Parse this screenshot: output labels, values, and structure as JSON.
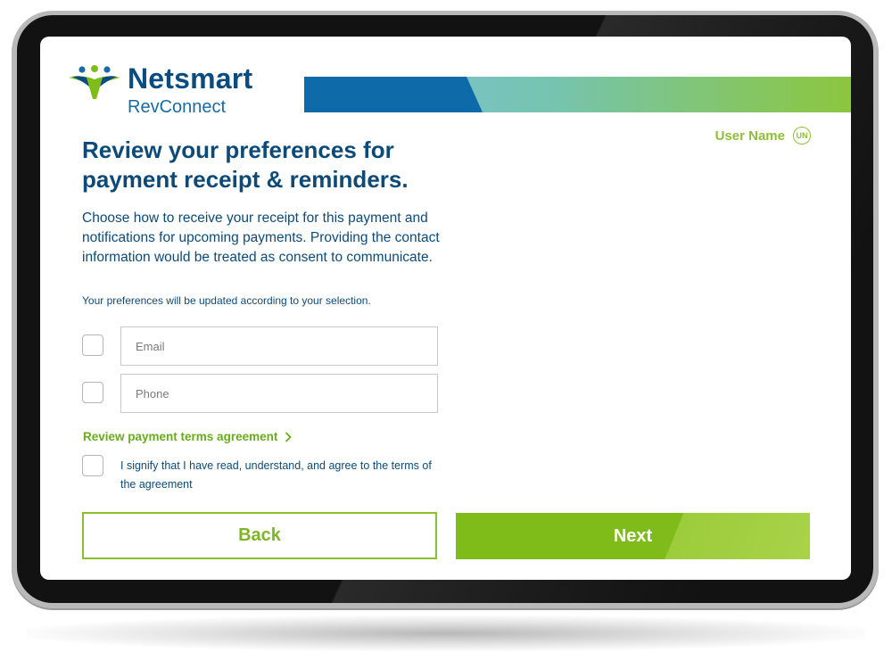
{
  "header": {
    "brand": "Netsmart",
    "product": "RevConnect",
    "logo_icon": "people-figures-logo-icon"
  },
  "user": {
    "name": "User Name",
    "initials": "UN"
  },
  "main": {
    "title": "Review your preferences for payment receipt & reminders.",
    "description": "Choose how to receive your receipt for this payment and notifications for upcoming payments. Providing the contact information would be treated as consent to communicate.",
    "note": "Your preferences will be updated according to your selection.",
    "email": {
      "placeholder": "Email",
      "value": ""
    },
    "phone": {
      "placeholder": "Phone",
      "value": ""
    },
    "terms_link": "Review payment terms agreement",
    "agreement": "I signify that I have read, understand, and agree to the terms of the agreement"
  },
  "actions": {
    "back_label": "Back",
    "next_label": "Next"
  },
  "colors": {
    "navy": "#0d4a78",
    "brand_blue": "#0a4c80",
    "green": "#7fbc1a",
    "light_green": "#8ebe3a"
  }
}
